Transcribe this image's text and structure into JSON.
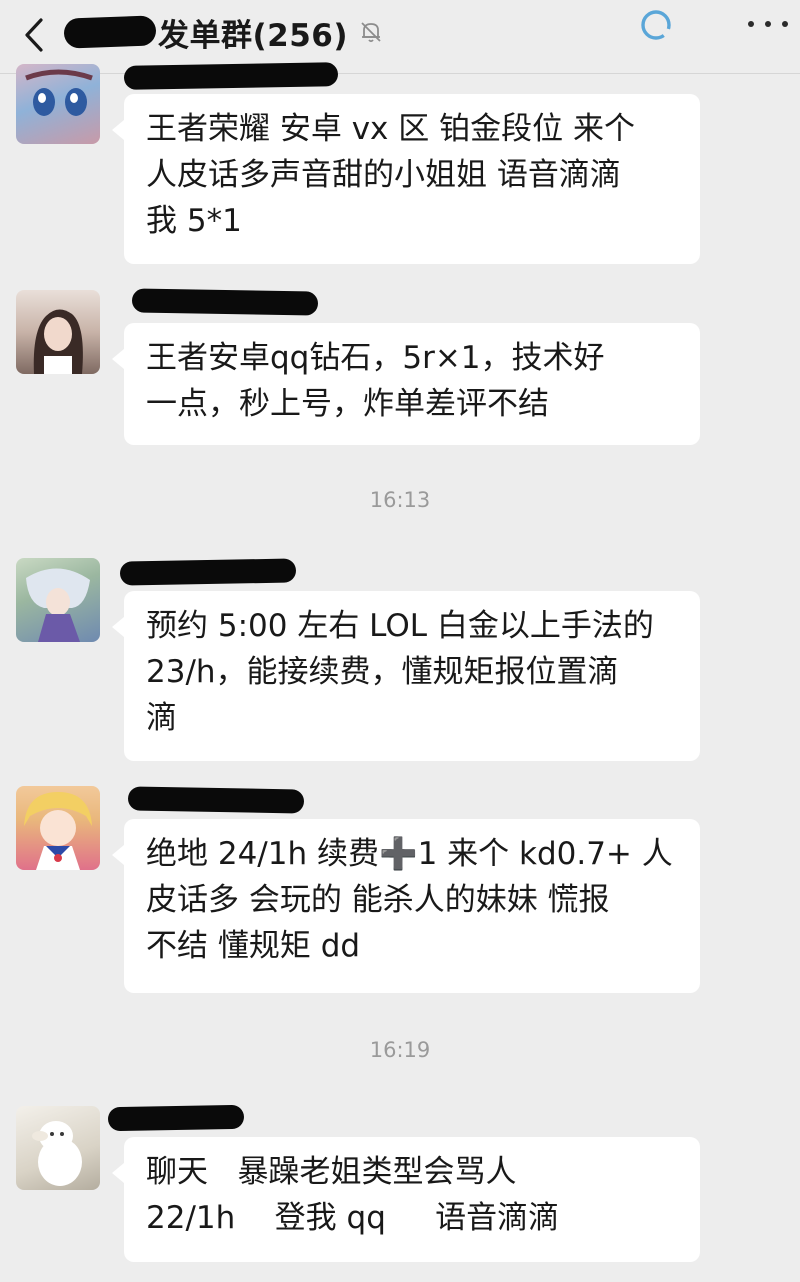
{
  "header": {
    "title": "发单群(256)",
    "back_icon": "back-chevron-icon",
    "mute_icon": "bell-off-icon",
    "status_icon": "loading-ring-icon",
    "more_icon": "more-dots-icon"
  },
  "colors": {
    "background": "#ededed",
    "bubble": "#ffffff",
    "ring": "#5aa6d8"
  },
  "messages": [
    {
      "text": "王者荣耀 安卓 vx 区 铂金段位 来个\n人皮话多声音甜的小姐姐 语音滴滴\n我 5*1"
    },
    {
      "text": "王者安卓qq钻石，5r×1，技术好\n一点，秒上号，炸单差评不结"
    },
    {
      "text": "预约 5:00 左右 LOL 白金以上手法的\n23/h，能接续费，懂规矩报位置滴\n滴"
    },
    {
      "text": "绝地 24/1h 续费➕1 来个 kd0.7+ 人\n皮话多 会玩的 能杀人的妹妹 慌报\n不结 懂规矩 dd"
    },
    {
      "text": "聊天   暴躁老姐类型会骂人\n22/1h    登我 qq     语音滴滴"
    }
  ],
  "timestamps": [
    "16:13",
    "16:19"
  ]
}
